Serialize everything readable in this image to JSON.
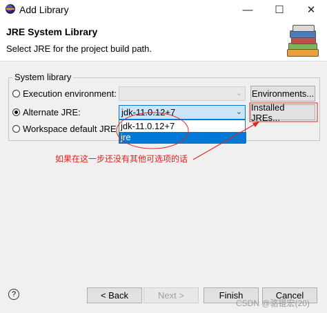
{
  "window": {
    "title": "Add Library",
    "minimize": "—",
    "maximize": "☐",
    "close": "✕"
  },
  "header": {
    "title": "JRE System Library",
    "description": "Select JRE for the project build path.",
    "banner_icon": "library-books-icon"
  },
  "group": {
    "label": "System library",
    "options": [
      {
        "label": "Execution environment:",
        "selected": false,
        "combo_value": "",
        "combo_enabled": false,
        "button": "Environments..."
      },
      {
        "label": "Alternate JRE:",
        "selected": true,
        "combo_value": "jdk-11.0.12+7",
        "combo_enabled": true,
        "button": "Installed JREs..."
      },
      {
        "label": "Workspace default JRE (jr",
        "selected": false
      }
    ]
  },
  "dropdown": {
    "items": [
      "jdk-11.0.12+7",
      "jre"
    ],
    "selected_index": 1
  },
  "annotation": {
    "text": "如果在这一步还没有其他可选项的话",
    "color": "#e0231c"
  },
  "footer": {
    "help": "?",
    "back": "< Back",
    "next": "Next >",
    "finish": "Finish",
    "cancel": "Cancel",
    "watermark": "CSDN @骆锟宏(20)"
  },
  "colors": {
    "accent": "#0078d7",
    "annotation": "#e0231c"
  }
}
